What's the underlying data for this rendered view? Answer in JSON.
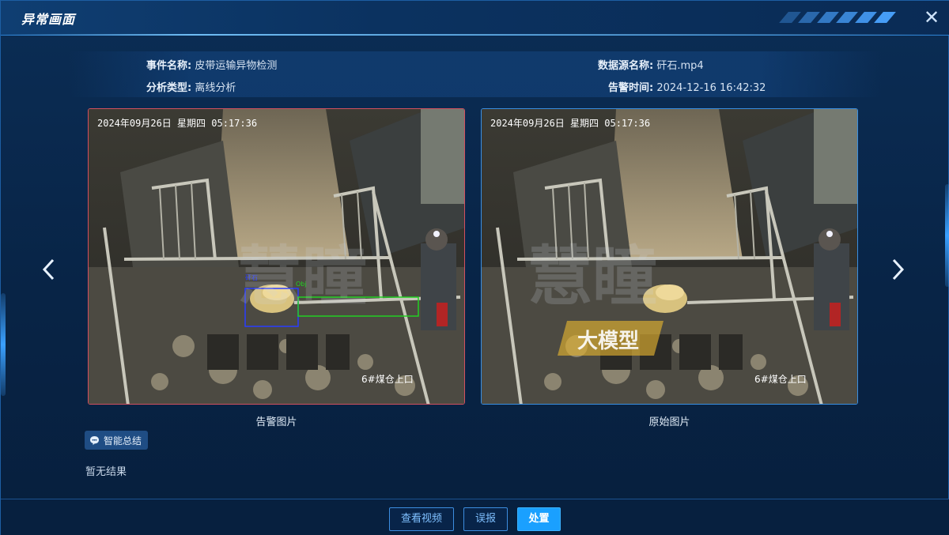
{
  "dialog": {
    "title": "异常画面",
    "close_icon": "close-icon"
  },
  "info": {
    "event_name_label": "事件名称:",
    "event_name_value": "皮带运输异物检测",
    "source_label": "数据源名称:",
    "source_value": "矸石.mp4",
    "analysis_type_label": "分析类型:",
    "analysis_type_value": "离线分析",
    "alarm_time_label": "告警时间:",
    "alarm_time_value": "2024-12-16 16:42:32"
  },
  "images": {
    "alert": {
      "caption": "告警图片",
      "timestamp": "2024年09月26日 星期四 05:17:36",
      "location": "6#煤仓上口"
    },
    "original": {
      "caption": "原始图片",
      "timestamp": "2024年09月26日 星期四 05:17:36",
      "location": "6#煤仓上口",
      "watermark_text": "大模型"
    }
  },
  "summary": {
    "tag_label": "智能总结",
    "result": "暂无结果"
  },
  "buttons": {
    "view_video": "查看视频",
    "false_report": "误报",
    "handle": "处置"
  },
  "colors": {
    "accent": "#1aa0ff",
    "alert_border": "#d2505f",
    "detect_box_blue": "#2a3cff",
    "detect_box_green": "#22d022"
  }
}
